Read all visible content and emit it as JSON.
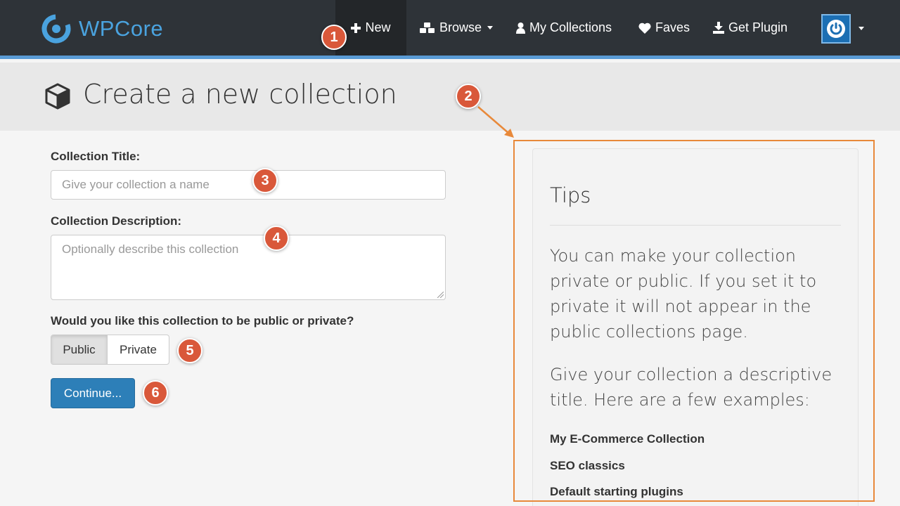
{
  "navbar": {
    "brand": "WPCore",
    "items": [
      {
        "label": "New",
        "icon": "plus-icon",
        "active": true
      },
      {
        "label": "Browse",
        "icon": "cubes-icon",
        "dropdown": true
      },
      {
        "label": "My Collections",
        "icon": "user-icon"
      },
      {
        "label": "Faves",
        "icon": "heart-icon"
      },
      {
        "label": "Get Plugin",
        "icon": "download-icon"
      }
    ],
    "user_menu_icon": "power-icon"
  },
  "header": {
    "title": "Create a new collection",
    "icon": "cube-icon"
  },
  "form": {
    "title_label": "Collection Title:",
    "title_placeholder": "Give your collection a name",
    "description_label": "Collection Description:",
    "description_placeholder": "Optionally describe this collection",
    "visibility_label": "Would you like this collection to be public or private?",
    "visibility_options": [
      "Public",
      "Private"
    ],
    "visibility_selected": "Public",
    "continue_label": "Continue..."
  },
  "tips": {
    "title": "Tips",
    "paragraphs": [
      "You can make your collection private or public. If you set it to private it will not appear in the public collections page.",
      "Give your collection a descriptive title. Here are a few examples:"
    ],
    "examples": [
      "My E-Commerce Collection",
      "SEO classics",
      "Default starting plugins"
    ]
  },
  "markers": [
    "1",
    "2",
    "3",
    "4",
    "5",
    "6"
  ],
  "colors": {
    "navbar_bg": "#2e3338",
    "brand": "#4aa3df",
    "accent_border": "#5a9bd5",
    "button_primary": "#2d7fb8",
    "marker": "#d9583a",
    "highlight_outline": "#e8893a"
  }
}
